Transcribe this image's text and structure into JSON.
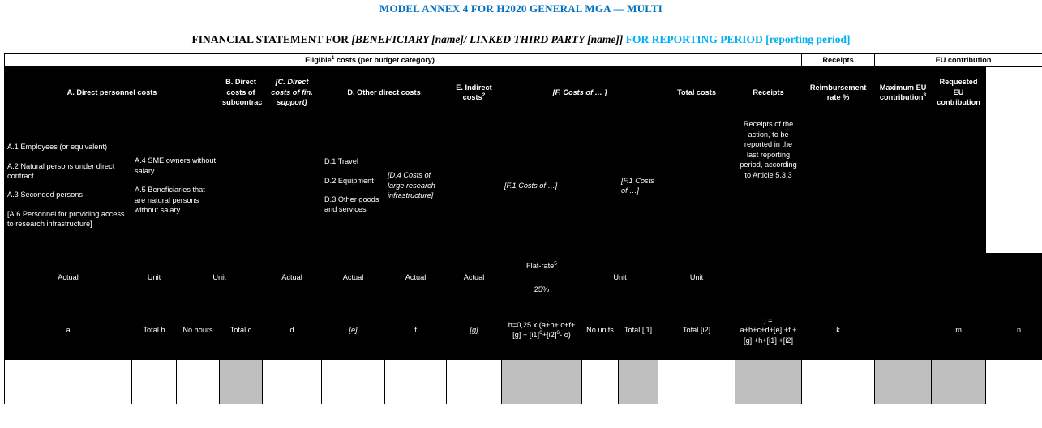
{
  "document": {
    "title": "MODEL ANNEX 4 FOR H2020 GENERAL MGA  — MULTI",
    "subtitle_prefix": "FINANCIAL STATEMENT FOR ",
    "subtitle_italic": "[BENEFICIARY [name]/ LINKED THIRD PARTY [name]]",
    "subtitle_cyan": "FOR REPORTING PERIOD [reporting period]"
  },
  "table": {
    "group_headers": {
      "eligible_costs": "Eligible",
      "eligible_costs_sup": "1",
      "eligible_costs_rest": " costs (per budget category)",
      "receipts": "Receipts",
      "eu_contribution": "EU contribution"
    },
    "column_headers": {
      "a_direct_personnel": "A. Direct personnel costs",
      "b_subcontracting": "B. Direct costs of subcontracting",
      "c_fin_support": "[C. Direct costs of fin. support]",
      "d_other_direct": "D. Other direct costs",
      "e_indirect": "E. Indirect costs",
      "e_indirect_sup": "2",
      "f_costs_of": "[F. Costs of …   ]",
      "total_costs": "Total costs",
      "receipts": "Receipts",
      "reimbursement_rate": "Reimbursement rate %",
      "max_eu_contribution": "Maximum EU contribution",
      "max_eu_contribution_sup": "3",
      "requested_eu_contribution": "Requested EU contribution"
    },
    "detail_row": {
      "a_actual_items": [
        "A.1 Employees (or equivalent)",
        "A.2 Natural persons under direct contract",
        "A.3 Seconded persons"
      ],
      "a_actual_bracketed": "[A.6 Personnel for providing access to research infrastructure]",
      "a_unit_items": [
        "A.4   SME owners without salary",
        "A.5 Beneficiaries that are natural persons without salary"
      ],
      "a_unit2": "",
      "b_subcontracting": "",
      "c_fin_support": "",
      "d_items": [
        "D.1 Travel",
        "D.2 Equipment",
        "D.3 Other goods and services"
      ],
      "d4": "[D.4 Costs of large research infrastructure]",
      "e_indirect": "",
      "f1_unit": "[F.1 Costs of …]",
      "f2_unit": "[F.1 Costs of …]",
      "total_costs": "",
      "receipts": "Receipts of the action, to be reported in the last reporting period, according to Article 5.3.3",
      "reimbursement_rate": "",
      "max_eu": "",
      "requested_eu": ""
    },
    "type_row": {
      "a_actual": "Actual",
      "a_unit": "Unit",
      "a_unit2": "Unit",
      "b": "Actual",
      "c": "Actual",
      "d": "Actual",
      "d4": "Actual",
      "e_flatrate": "Flat-rate",
      "e_flatrate_sup": "5",
      "e_percent": "25%",
      "f1": "Unit",
      "f2": "Unit",
      "total_costs": "",
      "receipts": "",
      "reimbursement_rate": "",
      "max_eu": "",
      "requested_eu": ""
    },
    "formula_row": {
      "a_actual": "a",
      "a_unit_total": "Total b",
      "f_no_hours": "No hours",
      "f_total_c": "Total c",
      "b": "d",
      "c": "[e]",
      "d": "f",
      "d4": "[g]",
      "e_line1": "h=0,25 x (a+b+",
      "e_line2a": "c+f+[g] + [i1]",
      "e_sup1": "6",
      "e_line2b": "+[i2]",
      "e_sup2": "6",
      "e_line2c": "- o)",
      "f1_no_units": "No units",
      "f1_total": "Total [i1]",
      "f2_total": "Total [i2]",
      "total_costs_eq": "j =",
      "total_costs_formula": "a+b+c+d+[e] +f +[g] +h+[i1] +[i2]",
      "receipts": "k",
      "reimbursement_rate": "l",
      "max_eu": "m",
      "requested_eu": "n"
    },
    "input_row": {
      "cells": [
        {
          "name": "input-a-actual",
          "shaded": false
        },
        {
          "name": "input-a-unit-total",
          "shaded": false
        },
        {
          "name": "input-no-hours",
          "shaded": false
        },
        {
          "name": "input-total-c",
          "shaded": true
        },
        {
          "name": "input-b-subcontracting",
          "shaded": false
        },
        {
          "name": "input-c-fin-support",
          "shaded": false
        },
        {
          "name": "input-d-other",
          "shaded": false
        },
        {
          "name": "input-d4",
          "shaded": false
        },
        {
          "name": "input-e-indirect",
          "shaded": true
        },
        {
          "name": "input-f1-no-units",
          "shaded": false
        },
        {
          "name": "input-f1-total",
          "shaded": true
        },
        {
          "name": "input-f2-total",
          "shaded": false
        },
        {
          "name": "input-total-costs",
          "shaded": true
        },
        {
          "name": "input-receipts",
          "shaded": false
        },
        {
          "name": "input-reimbursement-rate",
          "shaded": true
        },
        {
          "name": "input-max-eu",
          "shaded": true
        },
        {
          "name": "input-requested-eu",
          "shaded": false
        }
      ]
    }
  }
}
